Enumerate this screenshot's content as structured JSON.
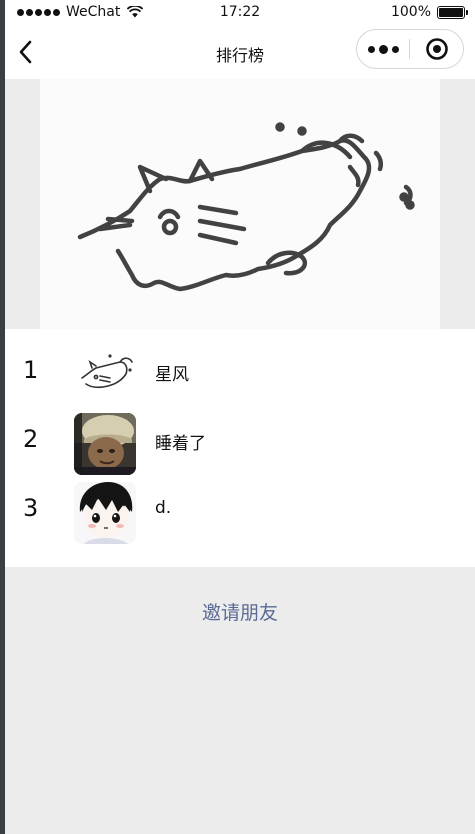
{
  "status_bar": {
    "carrier": "WeChat",
    "time": "17:22",
    "battery": "100%"
  },
  "nav": {
    "title": "排行榜"
  },
  "ranking": [
    {
      "rank": "1",
      "name": "星风",
      "avatar": "cat-sketch-avatar"
    },
    {
      "rank": "2",
      "name": "睡着了",
      "avatar": "beanie-photo-avatar"
    },
    {
      "rank": "3",
      "name": "d.",
      "avatar": "anime-boy-avatar"
    }
  ],
  "footer": {
    "invite_label": "邀请朋友"
  },
  "colors": {
    "link": "#5c6b95",
    "page_bg": "#ececec"
  }
}
